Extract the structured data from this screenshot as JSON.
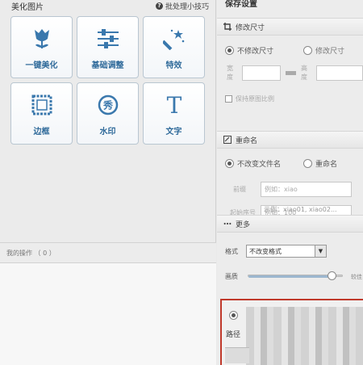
{
  "left": {
    "title": "美化图片",
    "tip": "批处理小技巧",
    "tiles": [
      {
        "label": "一键美化",
        "icon": "tulip-icon"
      },
      {
        "label": "基础调整",
        "icon": "sliders-icon"
      },
      {
        "label": "特效",
        "icon": "magic-wand-icon"
      },
      {
        "label": "边框",
        "icon": "frame-icon"
      },
      {
        "label": "水印",
        "icon": "watermark-icon",
        "glyph": "秀"
      },
      {
        "label": "文字",
        "icon": "text-icon",
        "glyph": "T"
      }
    ],
    "recent_label": "我的操作 （ 0 ）"
  },
  "right": {
    "title": "保存设置",
    "resize": {
      "header": "修改尺寸",
      "option_keep": "不修改尺寸",
      "option_change": "修改尺寸",
      "width_label": "宽度",
      "height_label": "高度",
      "keep_ratio": "保持原图比例"
    },
    "rename": {
      "header": "重命名",
      "option_keep": "不改变文件名",
      "option_rename": "重命名",
      "prefix_label": "前缀",
      "prefix_placeholder": "例如：xiao",
      "start_label": "起始序号",
      "start_placeholder": "例如：100",
      "example": "示例：xiao01, xiao02..."
    },
    "more": {
      "header": "更多",
      "format_label": "格式",
      "format_value": "不改变格式",
      "quality_label": "画质",
      "quality_end": "较佳",
      "quality_level": 0.88
    },
    "path_label": "路径"
  },
  "colors": {
    "tile_label": "#2f6a9a",
    "icon_blue": "#3a78ad",
    "highlight_red": "#c0392b"
  }
}
